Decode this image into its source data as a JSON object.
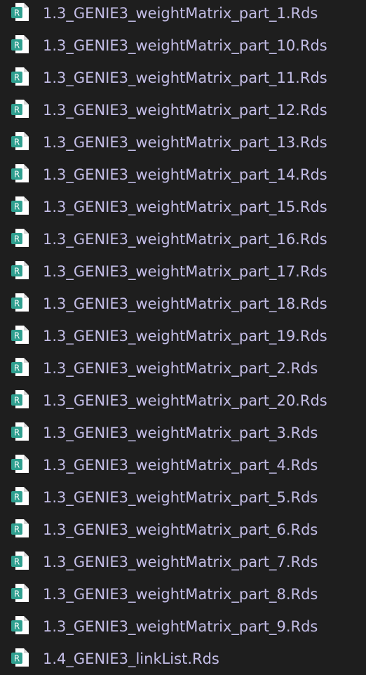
{
  "icon": "r-file-icon",
  "colors": {
    "background": "#1e1e1e",
    "text": "#c3bde6",
    "icon_page": "#ffffff",
    "icon_badge": "#2f9f8f",
    "icon_letter": "#ffffff"
  },
  "files": [
    {
      "name": "1.3_GENIE3_weightMatrix_part_1.Rds"
    },
    {
      "name": "1.3_GENIE3_weightMatrix_part_10.Rds"
    },
    {
      "name": "1.3_GENIE3_weightMatrix_part_11.Rds"
    },
    {
      "name": "1.3_GENIE3_weightMatrix_part_12.Rds"
    },
    {
      "name": "1.3_GENIE3_weightMatrix_part_13.Rds"
    },
    {
      "name": "1.3_GENIE3_weightMatrix_part_14.Rds"
    },
    {
      "name": "1.3_GENIE3_weightMatrix_part_15.Rds"
    },
    {
      "name": "1.3_GENIE3_weightMatrix_part_16.Rds"
    },
    {
      "name": "1.3_GENIE3_weightMatrix_part_17.Rds"
    },
    {
      "name": "1.3_GENIE3_weightMatrix_part_18.Rds"
    },
    {
      "name": "1.3_GENIE3_weightMatrix_part_19.Rds"
    },
    {
      "name": "1.3_GENIE3_weightMatrix_part_2.Rds"
    },
    {
      "name": "1.3_GENIE3_weightMatrix_part_20.Rds"
    },
    {
      "name": "1.3_GENIE3_weightMatrix_part_3.Rds"
    },
    {
      "name": "1.3_GENIE3_weightMatrix_part_4.Rds"
    },
    {
      "name": "1.3_GENIE3_weightMatrix_part_5.Rds"
    },
    {
      "name": "1.3_GENIE3_weightMatrix_part_6.Rds"
    },
    {
      "name": "1.3_GENIE3_weightMatrix_part_7.Rds"
    },
    {
      "name": "1.3_GENIE3_weightMatrix_part_8.Rds"
    },
    {
      "name": "1.3_GENIE3_weightMatrix_part_9.Rds"
    },
    {
      "name": "1.4_GENIE3_linkList.Rds"
    }
  ]
}
